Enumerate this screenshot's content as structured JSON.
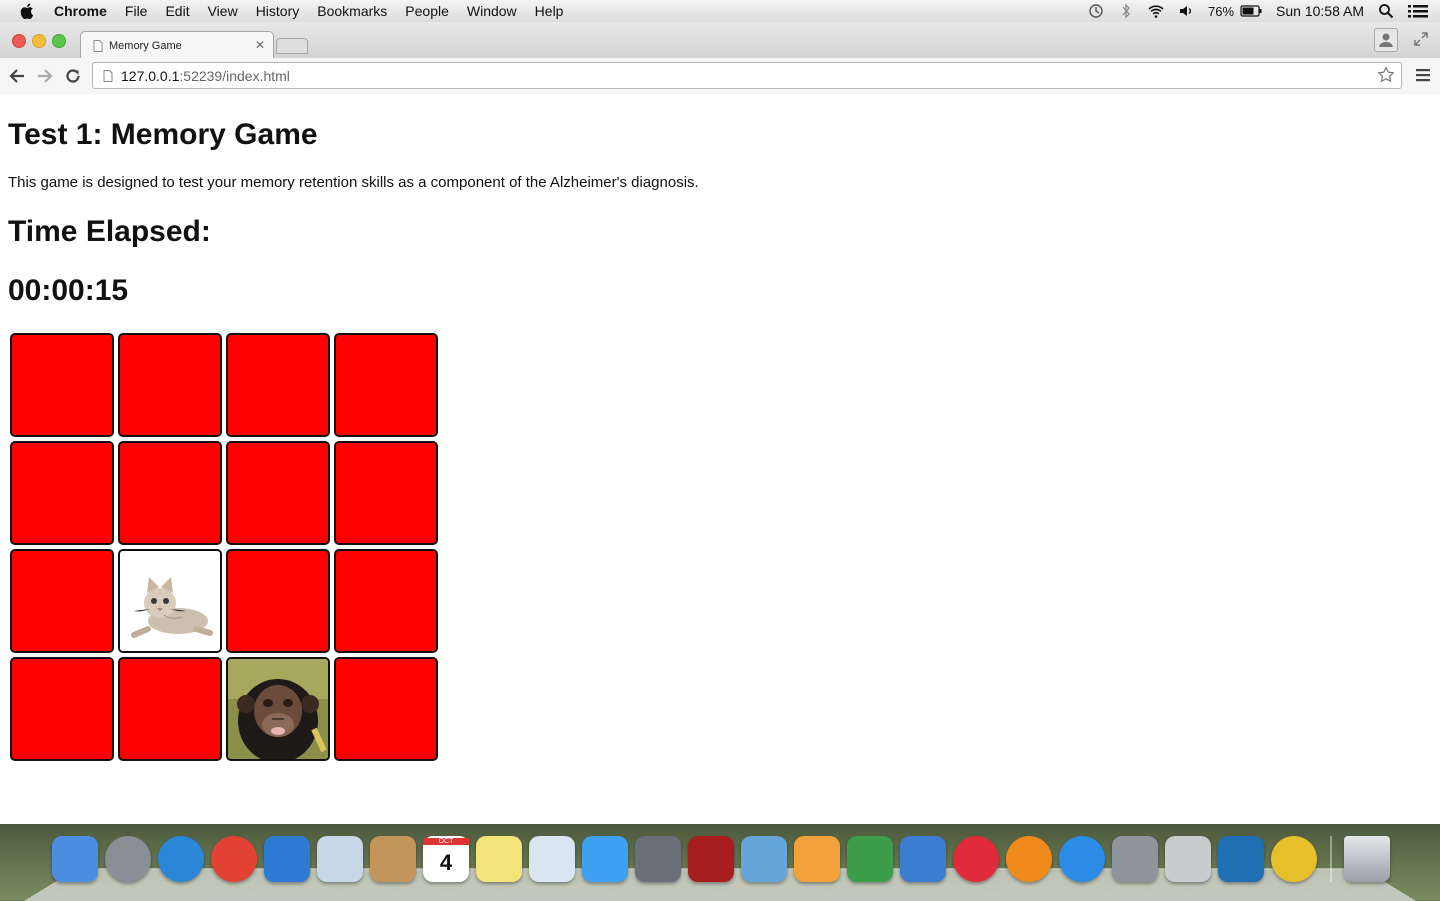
{
  "menubar": {
    "app": "Chrome",
    "items": [
      "File",
      "Edit",
      "View",
      "History",
      "Bookmarks",
      "People",
      "Window",
      "Help"
    ],
    "battery": "76%",
    "clock": "Sun 10:58 AM"
  },
  "browser": {
    "tab_title": "Memory Game",
    "url_host": "127.0.0.1",
    "url_rest": ":52239/index.html"
  },
  "page": {
    "title": "Test 1: Memory Game",
    "description": "This game is designed to test your memory retention skills as a component of the Alzheimer's diagnosis.",
    "time_heading": "Time Elapsed:",
    "time_value": "00:00:15"
  },
  "board": {
    "rows": 4,
    "cols": 4,
    "back_color": "#ff0000",
    "cards": [
      {
        "state": "down"
      },
      {
        "state": "down"
      },
      {
        "state": "down"
      },
      {
        "state": "down"
      },
      {
        "state": "down"
      },
      {
        "state": "down"
      },
      {
        "state": "down"
      },
      {
        "state": "down"
      },
      {
        "state": "down"
      },
      {
        "state": "up",
        "image": "kitten"
      },
      {
        "state": "down"
      },
      {
        "state": "down"
      },
      {
        "state": "down"
      },
      {
        "state": "down"
      },
      {
        "state": "up",
        "image": "chimpanzee"
      },
      {
        "state": "down"
      }
    ]
  },
  "dock": {
    "icons": [
      "finder-icon",
      "launchpad-icon",
      "safari-icon",
      "chrome-icon",
      "xcode-icon",
      "mail-icon",
      "contacts-icon",
      "calendar-icon",
      "notes-icon",
      "preview-icon",
      "messages-icon",
      "facetime-icon",
      "photo-booth-icon",
      "iphoto-icon",
      "pages-icon",
      "numbers-icon",
      "keynote-icon",
      "itunes-icon",
      "ibooks-icon",
      "app-store-icon",
      "system-preferences-icon",
      "calculator-icon",
      "brackets-icon",
      "chrome-canary-icon"
    ],
    "calendar_day": "4",
    "calendar_month": "OCT",
    "trash": "trash-icon"
  }
}
